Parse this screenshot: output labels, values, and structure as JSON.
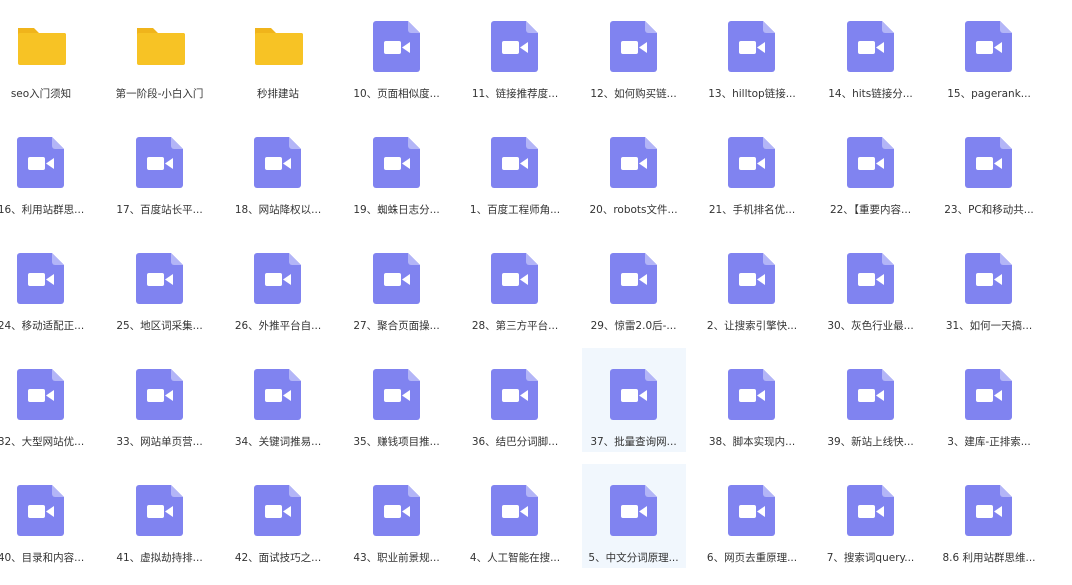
{
  "colors": {
    "folder": "#f7c325",
    "folder_tab": "#f0b41b",
    "video_file": "#8083f0",
    "video_fold": "#b3b5f7",
    "selected_bg": "#f1f7fd",
    "label_text": "#333333"
  },
  "files": [
    {
      "name": "seo入门须知",
      "type": "folder",
      "icon": "folder-icon"
    },
    {
      "name": "第一阶段-小白入门",
      "type": "folder",
      "icon": "folder-icon"
    },
    {
      "name": "秒排建站",
      "type": "folder",
      "icon": "folder-icon"
    },
    {
      "name": "10、页面相似度...",
      "type": "video",
      "icon": "video-file-icon"
    },
    {
      "name": "11、链接推荐度...",
      "type": "video",
      "icon": "video-file-icon"
    },
    {
      "name": "12、如何购买链...",
      "type": "video",
      "icon": "video-file-icon"
    },
    {
      "name": "13、hilltop链接...",
      "type": "video",
      "icon": "video-file-icon"
    },
    {
      "name": "14、hits链接分...",
      "type": "video",
      "icon": "video-file-icon"
    },
    {
      "name": "15、pagerank...",
      "type": "video",
      "icon": "video-file-icon"
    },
    {
      "name": "16、利用站群思...",
      "type": "video",
      "icon": "video-file-icon"
    },
    {
      "name": "17、百度站长平...",
      "type": "video",
      "icon": "video-file-icon"
    },
    {
      "name": "18、网站降权以...",
      "type": "video",
      "icon": "video-file-icon"
    },
    {
      "name": "19、蜘蛛日志分...",
      "type": "video",
      "icon": "video-file-icon"
    },
    {
      "name": "1、百度工程师角...",
      "type": "video",
      "icon": "video-file-icon"
    },
    {
      "name": "20、robots文件...",
      "type": "video",
      "icon": "video-file-icon"
    },
    {
      "name": "21、手机排名优...",
      "type": "video",
      "icon": "video-file-icon"
    },
    {
      "name": "22、【重要内容...",
      "type": "video",
      "icon": "video-file-icon"
    },
    {
      "name": "23、PC和移动共...",
      "type": "video",
      "icon": "video-file-icon"
    },
    {
      "name": "24、移动适配正...",
      "type": "video",
      "icon": "video-file-icon"
    },
    {
      "name": "25、地区词采集...",
      "type": "video",
      "icon": "video-file-icon"
    },
    {
      "name": "26、外推平台自...",
      "type": "video",
      "icon": "video-file-icon"
    },
    {
      "name": "27、聚合页面操...",
      "type": "video",
      "icon": "video-file-icon"
    },
    {
      "name": "28、第三方平台...",
      "type": "video",
      "icon": "video-file-icon"
    },
    {
      "name": "29、惊雷2.0后-...",
      "type": "video",
      "icon": "video-file-icon"
    },
    {
      "name": "2、让搜索引擎快...",
      "type": "video",
      "icon": "video-file-icon"
    },
    {
      "name": "30、灰色行业最...",
      "type": "video",
      "icon": "video-file-icon"
    },
    {
      "name": "31、如何一天搞...",
      "type": "video",
      "icon": "video-file-icon"
    },
    {
      "name": "32、大型网站优...",
      "type": "video",
      "icon": "video-file-icon"
    },
    {
      "name": "33、网站单页营...",
      "type": "video",
      "icon": "video-file-icon"
    },
    {
      "name": "34、关键词推易...",
      "type": "video",
      "icon": "video-file-icon"
    },
    {
      "name": "35、赚钱项目推...",
      "type": "video",
      "icon": "video-file-icon"
    },
    {
      "name": "36、结巴分词脚...",
      "type": "video",
      "icon": "video-file-icon"
    },
    {
      "name": "37、批量查询网...",
      "type": "video",
      "icon": "video-file-icon",
      "selected": true
    },
    {
      "name": "38、脚本实现内...",
      "type": "video",
      "icon": "video-file-icon"
    },
    {
      "name": "39、新站上线快...",
      "type": "video",
      "icon": "video-file-icon"
    },
    {
      "name": "3、建库-正排索...",
      "type": "video",
      "icon": "video-file-icon"
    },
    {
      "name": "40、目录和内容...",
      "type": "video",
      "icon": "video-file-icon"
    },
    {
      "name": "41、虚拟劫持排...",
      "type": "video",
      "icon": "video-file-icon"
    },
    {
      "name": "42、面试技巧之...",
      "type": "video",
      "icon": "video-file-icon"
    },
    {
      "name": "43、职业前景规...",
      "type": "video",
      "icon": "video-file-icon"
    },
    {
      "name": "4、人工智能在搜...",
      "type": "video",
      "icon": "video-file-icon"
    },
    {
      "name": "5、中文分词原理...",
      "type": "video",
      "icon": "video-file-icon",
      "selected": true
    },
    {
      "name": "6、网页去重原理...",
      "type": "video",
      "icon": "video-file-icon"
    },
    {
      "name": "7、搜索词query...",
      "type": "video",
      "icon": "video-file-icon"
    },
    {
      "name": "8.6 利用站群思维...",
      "type": "video",
      "icon": "video-file-icon"
    }
  ]
}
